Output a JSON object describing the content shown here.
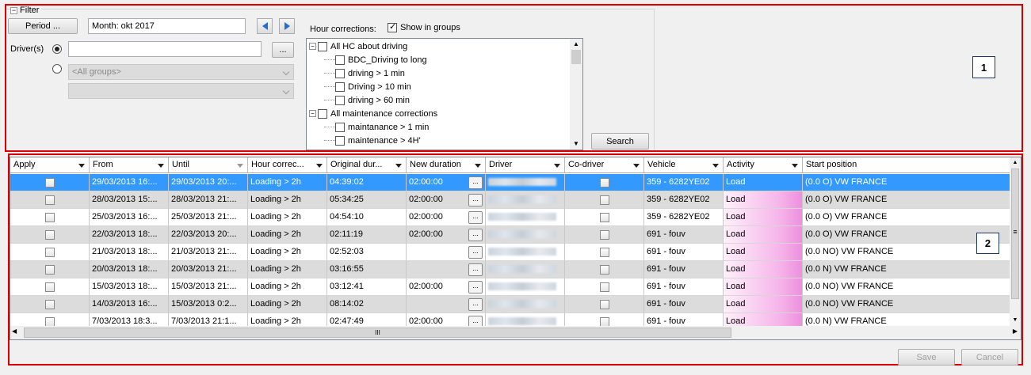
{
  "filter": {
    "section_label": "Filter",
    "period_button": "Period ...",
    "month_value": "Month: okt 2017",
    "drivers_label": "Driver(s)",
    "driver_input_value": "",
    "browse_button": "...",
    "group_select": "<All groups>",
    "group_select_2": "",
    "hour_corrections_label": "Hour corrections:",
    "show_in_groups_label": "Show in groups",
    "search_button": "Search",
    "tree": [
      {
        "label": "All HC about driving",
        "level": 0,
        "expander": "−"
      },
      {
        "label": "BDC_Driving to long",
        "level": 1
      },
      {
        "label": "driving > 1 min",
        "level": 1
      },
      {
        "label": "Driving > 10 min",
        "level": 1
      },
      {
        "label": "driving > 60 min",
        "level": 1
      },
      {
        "label": "All maintenance corrections",
        "level": 0,
        "expander": "−"
      },
      {
        "label": "maintanance > 1 min",
        "level": 1
      },
      {
        "label": "maintenance   > 4H'",
        "level": 1
      }
    ]
  },
  "annotations": {
    "box1": "1",
    "box2": "2"
  },
  "grid": {
    "columns": [
      "Apply",
      "From",
      "Until",
      "Hour correc...",
      "Original dur...",
      "New duration",
      "Driver",
      "Co-driver",
      "Vehicle",
      "Activity",
      "Start position"
    ],
    "rows": [
      {
        "from": "29/03/2013 16:...",
        "until": "29/03/2013 20:...",
        "hc": "Loading > 2h",
        "orig": "04:39:02",
        "newdur": "02:00:00",
        "vehicle": "359 - 6282YE02",
        "activity": "Load",
        "start": "(0.0 O) VW FRANCE"
      },
      {
        "from": "28/03/2013 15:...",
        "until": "28/03/2013 21:...",
        "hc": "Loading > 2h",
        "orig": "05:34:25",
        "newdur": "02:00:00",
        "vehicle": "359 - 6282YE02",
        "activity": "Load",
        "start": "(0.0 O) VW FRANCE"
      },
      {
        "from": "25/03/2013 16:...",
        "until": "25/03/2013 21:...",
        "hc": "Loading > 2h",
        "orig": "04:54:10",
        "newdur": "02:00:00",
        "vehicle": "359 - 6282YE02",
        "activity": "Load",
        "start": "(0.0 O) VW FRANCE"
      },
      {
        "from": "22/03/2013 18:...",
        "until": "22/03/2013 20:...",
        "hc": "Loading > 2h",
        "orig": "02:11:19",
        "newdur": "02:00:00",
        "vehicle": "691 - fouv",
        "activity": "Load",
        "start": "(0.0 O) VW FRANCE"
      },
      {
        "from": "21/03/2013 18:...",
        "until": "21/03/2013 21:...",
        "hc": "Loading > 2h",
        "orig": "02:52:03",
        "newdur": "",
        "vehicle": "691 - fouv",
        "activity": "Load",
        "start": "(0.0 NO) VW FRANCE"
      },
      {
        "from": "20/03/2013 18:...",
        "until": "20/03/2013 21:...",
        "hc": "Loading > 2h",
        "orig": "03:16:55",
        "newdur": "",
        "vehicle": "691 - fouv",
        "activity": "Load",
        "start": "(0.0 N) VW FRANCE"
      },
      {
        "from": "15/03/2013 18:...",
        "until": "15/03/2013 21:...",
        "hc": "Loading > 2h",
        "orig": "03:12:41",
        "newdur": "02:00:00",
        "vehicle": "691 - fouv",
        "activity": "Load",
        "start": "(0.0 NO) VW FRANCE"
      },
      {
        "from": "14/03/2013 16:...",
        "until": "15/03/2013 0:2...",
        "hc": "Loading > 2h",
        "orig": "08:14:02",
        "newdur": "",
        "vehicle": "691 - fouv",
        "activity": "Load",
        "start": "(0.0 NO) VW FRANCE"
      },
      {
        "from": "7/03/2013 18:3...",
        "until": "7/03/2013 21:1...",
        "hc": "Loading > 2h",
        "orig": "02:47:49",
        "newdur": "02:00:00",
        "vehicle": "691 - fouv",
        "activity": "Load",
        "start": "(0.0 N) VW FRANCE"
      }
    ],
    "cell_button": "...",
    "hscroll_grip": "III",
    "vscroll_grip": "≡"
  },
  "footer": {
    "save_button": "Save",
    "cancel_button": "Cancel"
  },
  "colors": {
    "annotation_red": "#d80000",
    "selection": "#3399ff",
    "nav_arrow": "#1e6fd0"
  }
}
